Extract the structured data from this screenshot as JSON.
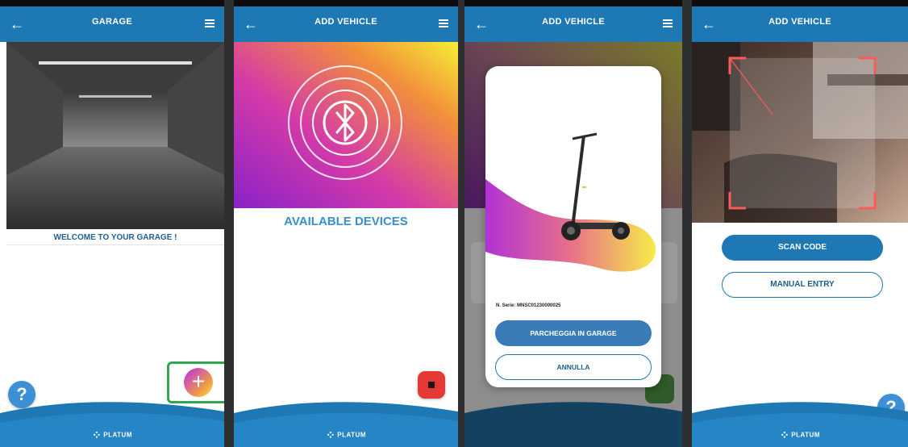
{
  "screens": [
    {
      "title": "GARAGE",
      "welcome": "WELCOME TO YOUR GARAGE !",
      "add_icon": "plus-icon",
      "help": "?",
      "brand": "PLATUM"
    },
    {
      "title": "ADD VEHICLE",
      "heading": "AVAILABLE DEVICES",
      "bluetooth_icon": "bluetooth-icon",
      "brand": "PLATUM"
    },
    {
      "title": "ADD VEHICLE",
      "serial_label": "N. Serie: MNSC01230000025",
      "park_button": "PARCHEGGIA IN GARAGE",
      "cancel_button": "ANNULLA"
    },
    {
      "title": "ADD VEHICLE",
      "scan_button": "SCAN CODE",
      "manual_button": "MANUAL ENTRY",
      "help": "?",
      "brand": "PLATUM"
    }
  ],
  "colors": {
    "topbar": "#1e78b4",
    "highlight": "#2fa84f",
    "stop": "#e53935",
    "accent_magenta": "#c23ad6",
    "accent_yellow": "#f6e54b"
  }
}
